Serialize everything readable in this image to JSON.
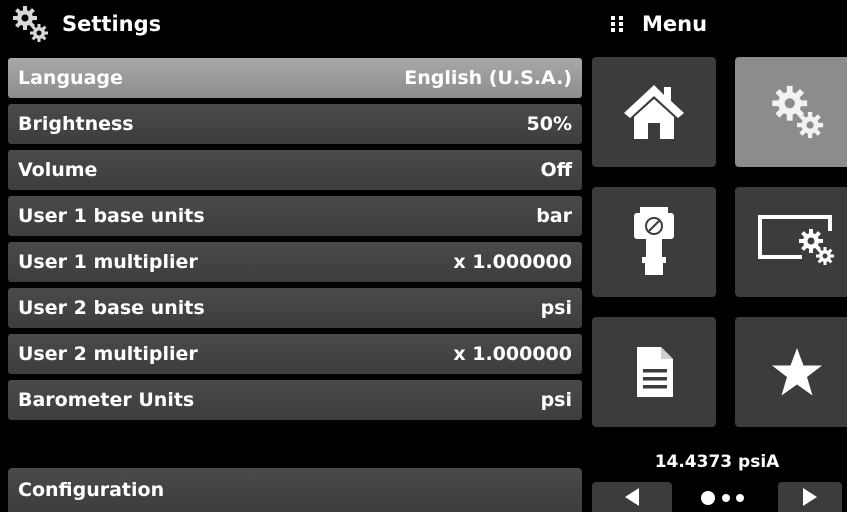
{
  "header": {
    "title": "Settings",
    "menu_label": "Menu"
  },
  "settings_rows": [
    {
      "label": "Language",
      "value": "English (U.S.A.)",
      "selected": true
    },
    {
      "label": "Brightness",
      "value": "50%"
    },
    {
      "label": "Volume",
      "value": "Off"
    },
    {
      "label": "User 1 base units",
      "value": "bar"
    },
    {
      "label": "User 1 multiplier",
      "value": "x 1.000000"
    },
    {
      "label": "User 2 base units",
      "value": "psi"
    },
    {
      "label": "User 2 multiplier",
      "value": "x 1.000000"
    },
    {
      "label": "Barometer Units",
      "value": "psi"
    }
  ],
  "configuration": {
    "label": "Configuration"
  },
  "menu_tiles": [
    {
      "icon": "home-icon",
      "active": false
    },
    {
      "icon": "settings-gears-icon",
      "active": true
    },
    {
      "icon": "pressure-sensor-icon",
      "active": false
    },
    {
      "icon": "display-settings-icon",
      "active": false
    },
    {
      "icon": "document-icon",
      "active": false
    },
    {
      "icon": "star-icon",
      "active": false
    }
  ],
  "status": {
    "pressure": "14.4373 psiA"
  },
  "pager": {
    "pages": 3,
    "current": 1
  },
  "colors": {
    "row": "#444444",
    "row_selected": "#9b9b9b",
    "tile": "#3c3c3c",
    "tile_active": "#8c8c8c",
    "background": "#000000"
  }
}
